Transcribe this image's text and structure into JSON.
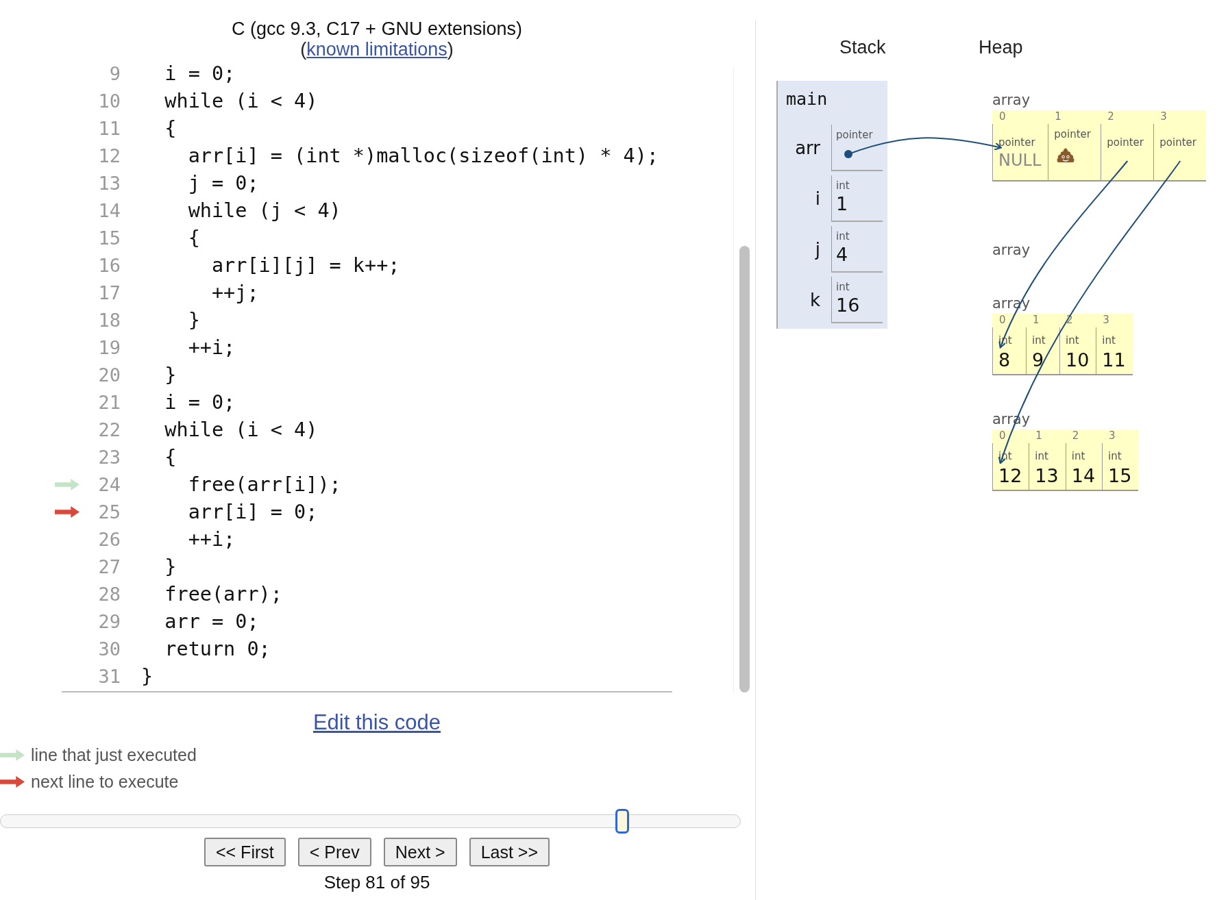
{
  "header": {
    "title": "C (gcc 9.3, C17 + GNU extensions)",
    "open_paren": "(",
    "link": "known limitations",
    "close_paren": ")"
  },
  "code": {
    "lines": [
      {
        "num": "9",
        "text": "  i = 0;",
        "executed": false,
        "next": false
      },
      {
        "num": "10",
        "text": "  while (i < 4)",
        "executed": false,
        "next": false
      },
      {
        "num": "11",
        "text": "  {",
        "executed": false,
        "next": false
      },
      {
        "num": "12",
        "text": "    arr[i] = (int *)malloc(sizeof(int) * 4);",
        "executed": false,
        "next": false
      },
      {
        "num": "13",
        "text": "    j = 0;",
        "executed": false,
        "next": false
      },
      {
        "num": "14",
        "text": "    while (j < 4)",
        "executed": false,
        "next": false
      },
      {
        "num": "15",
        "text": "    {",
        "executed": false,
        "next": false
      },
      {
        "num": "16",
        "text": "      arr[i][j] = k++;",
        "executed": false,
        "next": false
      },
      {
        "num": "17",
        "text": "      ++j;",
        "executed": false,
        "next": false
      },
      {
        "num": "18",
        "text": "    }",
        "executed": false,
        "next": false
      },
      {
        "num": "19",
        "text": "    ++i;",
        "executed": false,
        "next": false
      },
      {
        "num": "20",
        "text": "  }",
        "executed": false,
        "next": false
      },
      {
        "num": "21",
        "text": "  i = 0;",
        "executed": false,
        "next": false
      },
      {
        "num": "22",
        "text": "  while (i < 4)",
        "executed": false,
        "next": false
      },
      {
        "num": "23",
        "text": "  {",
        "executed": false,
        "next": false
      },
      {
        "num": "24",
        "text": "    free(arr[i]);",
        "executed": true,
        "next": false
      },
      {
        "num": "25",
        "text": "    arr[i] = 0;",
        "executed": false,
        "next": true
      },
      {
        "num": "26",
        "text": "    ++i;",
        "executed": false,
        "next": false
      },
      {
        "num": "27",
        "text": "  }",
        "executed": false,
        "next": false
      },
      {
        "num": "28",
        "text": "  free(arr);",
        "executed": false,
        "next": false
      },
      {
        "num": "29",
        "text": "  arr = 0;",
        "executed": false,
        "next": false
      },
      {
        "num": "30",
        "text": "  return 0;",
        "executed": false,
        "next": false
      },
      {
        "num": "31",
        "text": "}",
        "executed": false,
        "next": false
      }
    ]
  },
  "edit_link": "Edit this code",
  "legend": [
    {
      "kind": "executed",
      "text": "line that just executed"
    },
    {
      "kind": "next",
      "text": "next line to execute"
    }
  ],
  "slider": {
    "level": 0.84
  },
  "buttons": [
    "<< First",
    "< Prev",
    "Next >",
    "Last >>"
  ],
  "step": "Step 81 of 95",
  "stack": {
    "title": "Stack",
    "frame": {
      "name": "main",
      "vars": [
        {
          "name": "arr",
          "type": "pointer",
          "kind": "pointer"
        },
        {
          "name": "i",
          "type": "int",
          "kind": "value",
          "value": "1"
        },
        {
          "name": "j",
          "type": "int",
          "kind": "value",
          "value": "4"
        },
        {
          "name": "k",
          "type": "int",
          "kind": "value",
          "value": "16"
        }
      ]
    }
  },
  "heap": {
    "title": "Heap",
    "arrays": [
      {
        "label": "array",
        "cells": [
          {
            "index": "0",
            "type": "pointer",
            "kind": "null",
            "value": "NULL"
          },
          {
            "index": "1",
            "type": "pointer",
            "kind": "dangling"
          },
          {
            "index": "2",
            "type": "pointer",
            "kind": "pointer"
          },
          {
            "index": "3",
            "type": "pointer",
            "kind": "pointer"
          }
        ]
      },
      {
        "label": "array"
      },
      {
        "label": "array",
        "cells": [
          {
            "index": "0",
            "type": "int",
            "kind": "value",
            "value": "8"
          },
          {
            "index": "1",
            "type": "int",
            "kind": "value",
            "value": "9"
          },
          {
            "index": "2",
            "type": "int",
            "kind": "value",
            "value": "10"
          },
          {
            "index": "3",
            "type": "int",
            "kind": "value",
            "value": "11"
          }
        ]
      },
      {
        "label": "array",
        "cells": [
          {
            "index": "0",
            "type": "int",
            "kind": "value",
            "value": "12"
          },
          {
            "index": "1",
            "type": "int",
            "kind": "value",
            "value": "13"
          },
          {
            "index": "2",
            "type": "int",
            "kind": "value",
            "value": "14"
          },
          {
            "index": "3",
            "type": "int",
            "kind": "value",
            "value": "15"
          }
        ]
      }
    ]
  }
}
